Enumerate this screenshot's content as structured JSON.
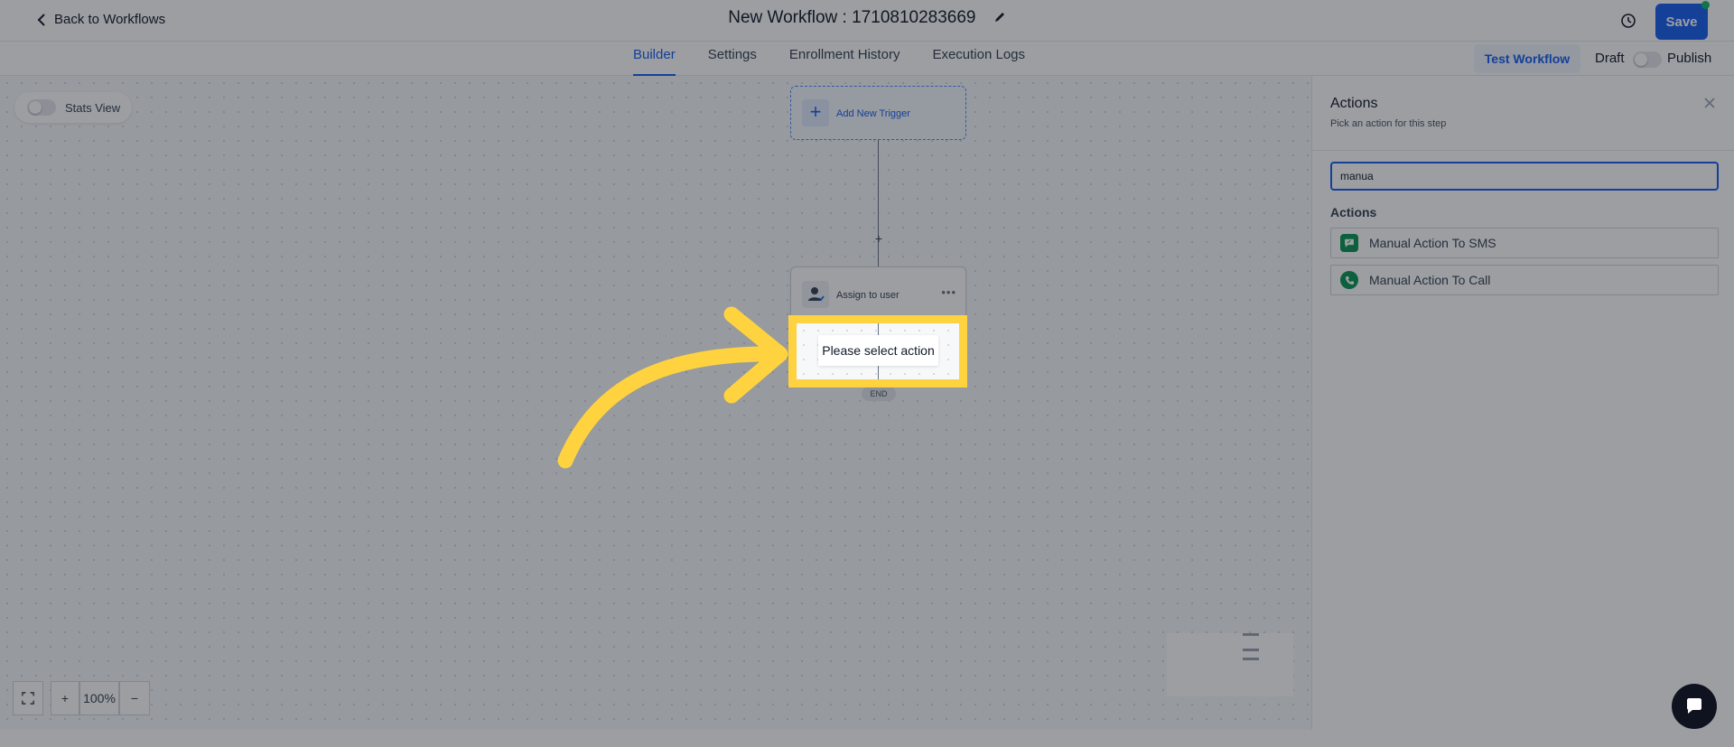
{
  "header": {
    "back_label": "Back to Workflows",
    "workflow_title": "New Workflow : 1710810283669",
    "save_label": "Save"
  },
  "nav": {
    "tabs": [
      {
        "label": "Builder",
        "active": true
      },
      {
        "label": "Settings",
        "active": false
      },
      {
        "label": "Enrollment History",
        "active": false
      },
      {
        "label": "Execution Logs",
        "active": false
      }
    ],
    "test_label": "Test Workflow",
    "draft_label": "Draft",
    "publish_label": "Publish",
    "publish_on": false
  },
  "canvas": {
    "stats_label": "Stats View",
    "stats_on": false,
    "trigger_label": "Add New Trigger",
    "action_label": "Assign to user",
    "select_action_label": "Please select action",
    "end_label": "END",
    "zoom_level": "100%",
    "zoom_in": "+",
    "zoom_out": "−"
  },
  "panel": {
    "title": "Actions",
    "subtitle": "Pick an action for this step",
    "search_value": "manua",
    "section_label": "Actions",
    "items": [
      {
        "label": "Manual Action To SMS",
        "icon": "sms-icon"
      },
      {
        "label": "Manual Action To Call",
        "icon": "phone-icon"
      }
    ]
  },
  "colors": {
    "accent": "#155eef",
    "highlight": "#ffd23f",
    "success": "#079455"
  }
}
